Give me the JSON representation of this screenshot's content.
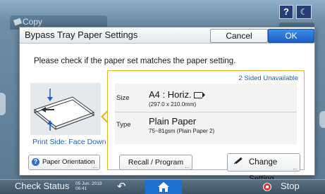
{
  "background": {
    "copy_tab_label": "Copy",
    "help_label": "?",
    "energy_label": "☾"
  },
  "dialog": {
    "title": "Bypass Tray Paper Settings",
    "cancel_label": "Cancel",
    "ok_label": "OK",
    "instruction": "Please check if the paper set matches the paper setting.",
    "print_side": "Print Side: Face Down",
    "panel": {
      "unavailable": "2 Sided Unavailable",
      "size_label": "Size",
      "size_value": "A4 : Horiz.",
      "size_detail": "(297.0 x 210.0mm)",
      "type_label": "Type",
      "type_value": "Plain Paper",
      "type_detail": "75~81gsm (Plain Paper 2)"
    },
    "buttons": {
      "paper_orientation": "Paper Orientation",
      "recall_program": "Recall / Program",
      "change_setting": "Change Setting",
      "more_indicator": "..."
    }
  },
  "statusbar": {
    "check_status": "Check Status",
    "date": "05 Jun. 2019",
    "time": "06:41",
    "back_icon": "↶",
    "stop_label": "Stop"
  },
  "colors": {
    "accent_blue": "#1b5fc4",
    "panel_border": "#e7b21e",
    "home_blue": "#1e6fd0",
    "stop_red": "#d9342b"
  }
}
